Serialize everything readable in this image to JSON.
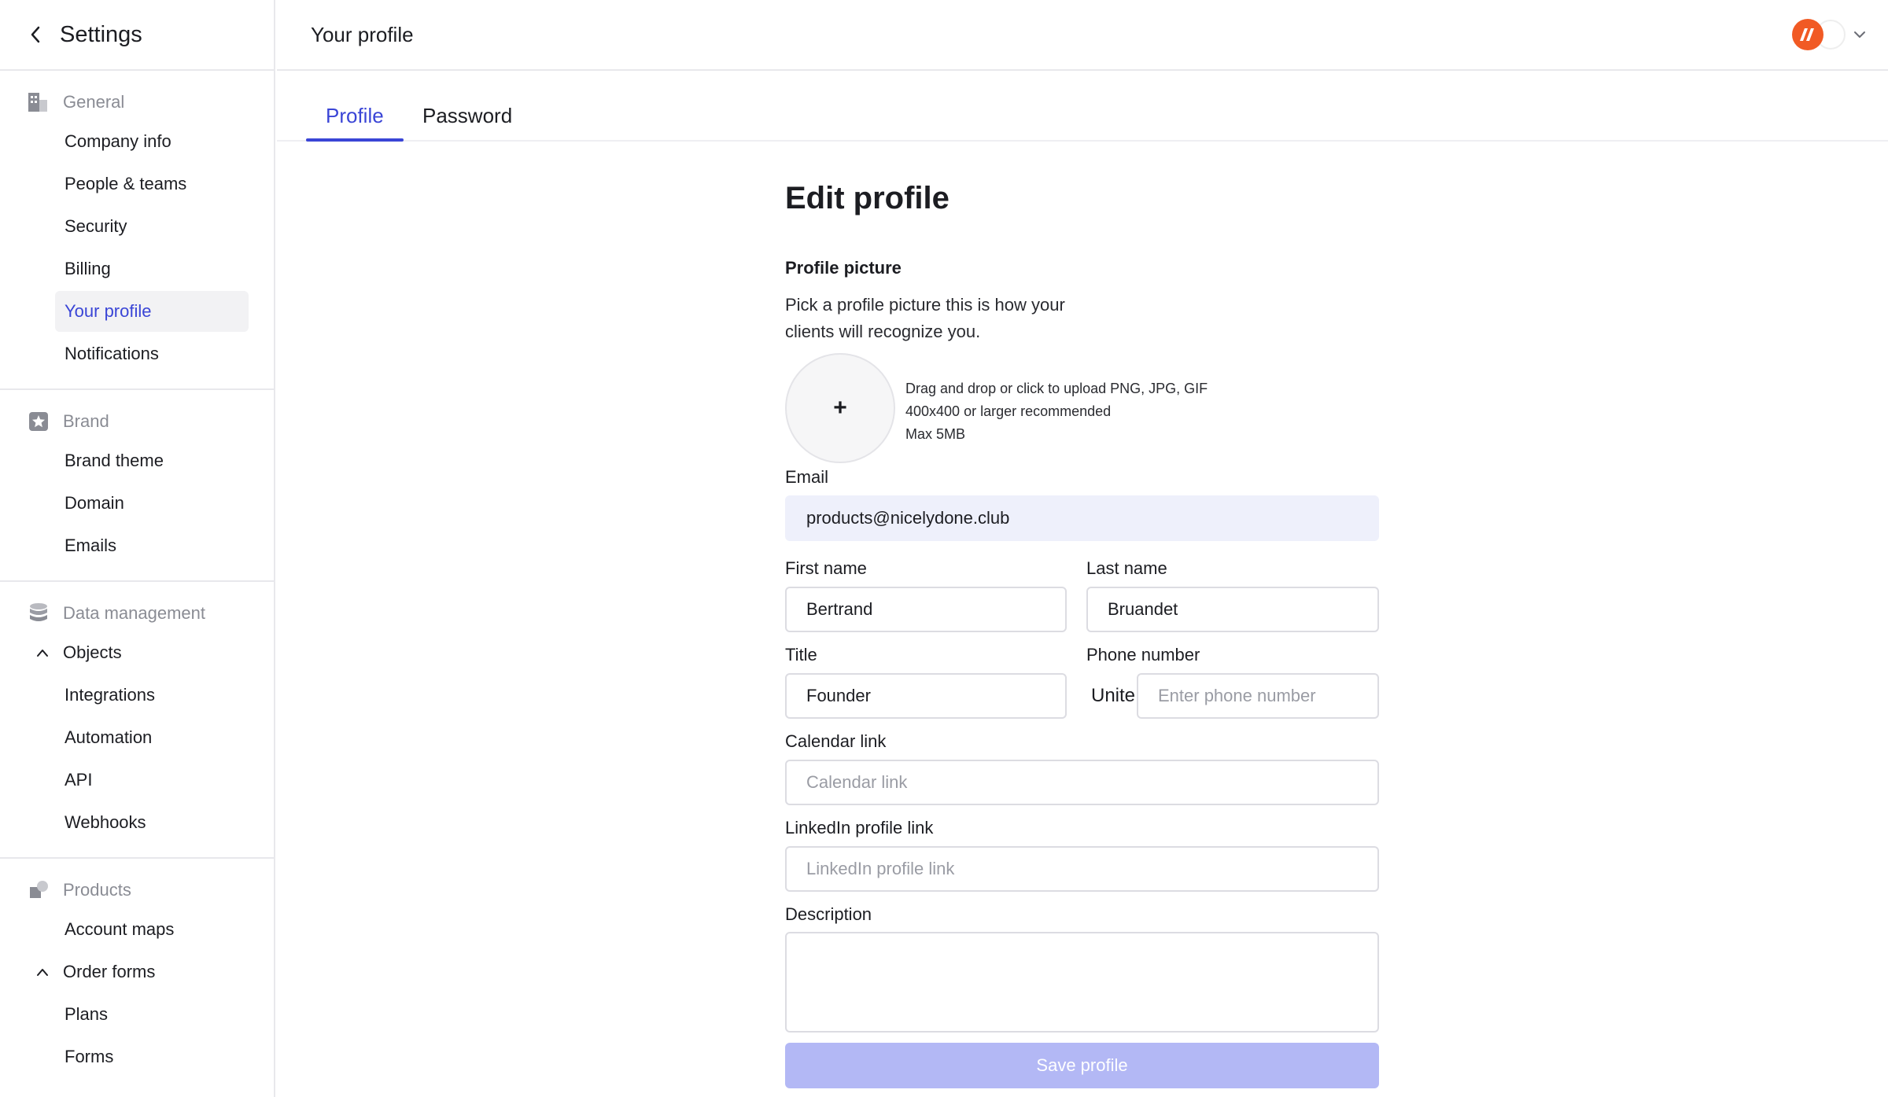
{
  "sidebar": {
    "title": "Settings",
    "sections": {
      "general": {
        "label": "General",
        "items": [
          "Company info",
          "People & teams",
          "Security",
          "Billing",
          "Your profile",
          "Notifications"
        ]
      },
      "brand": {
        "label": "Brand",
        "items": [
          "Brand theme",
          "Domain",
          "Emails"
        ]
      },
      "data": {
        "label": "Data management",
        "group": "Objects",
        "items": [
          "Integrations",
          "Automation",
          "API",
          "Webhooks"
        ]
      },
      "products": {
        "label": "Products",
        "items": [
          "Account maps"
        ],
        "group": "Order forms",
        "sub_items": [
          "Plans",
          "Forms"
        ]
      }
    },
    "active_item": "Your profile"
  },
  "header": {
    "title": "Your profile"
  },
  "tabs": [
    {
      "label": "Profile",
      "active": true
    },
    {
      "label": "Password",
      "active": false
    }
  ],
  "form": {
    "title": "Edit profile",
    "picture_label": "Profile picture",
    "picture_desc": "Pick a profile picture this is how your clients will recognize you.",
    "upload_plus": "+",
    "upload_hints": [
      "Drag and drop or click to upload PNG, JPG, GIF",
      "400x400 or larger recommended",
      "Max 5MB"
    ],
    "email": {
      "label": "Email",
      "value": "products@nicelydone.club"
    },
    "first_name": {
      "label": "First name",
      "value": "Bertrand"
    },
    "last_name": {
      "label": "Last name",
      "value": "Bruandet"
    },
    "title_field": {
      "label": "Title",
      "value": "Founder"
    },
    "phone": {
      "label": "Phone number",
      "country": "United States",
      "placeholder": "Enter phone number"
    },
    "calendar": {
      "label": "Calendar link",
      "placeholder": "Calendar link"
    },
    "linkedin": {
      "label": "LinkedIn profile link",
      "placeholder": "LinkedIn profile link"
    },
    "description": {
      "label": "Description",
      "value": ""
    },
    "save_label": "Save profile"
  },
  "colors": {
    "accent": "#3a45d6",
    "save_disabled": "#b3b8f5",
    "readonly_bg": "#eef0fb",
    "logo": "#f15a24"
  }
}
